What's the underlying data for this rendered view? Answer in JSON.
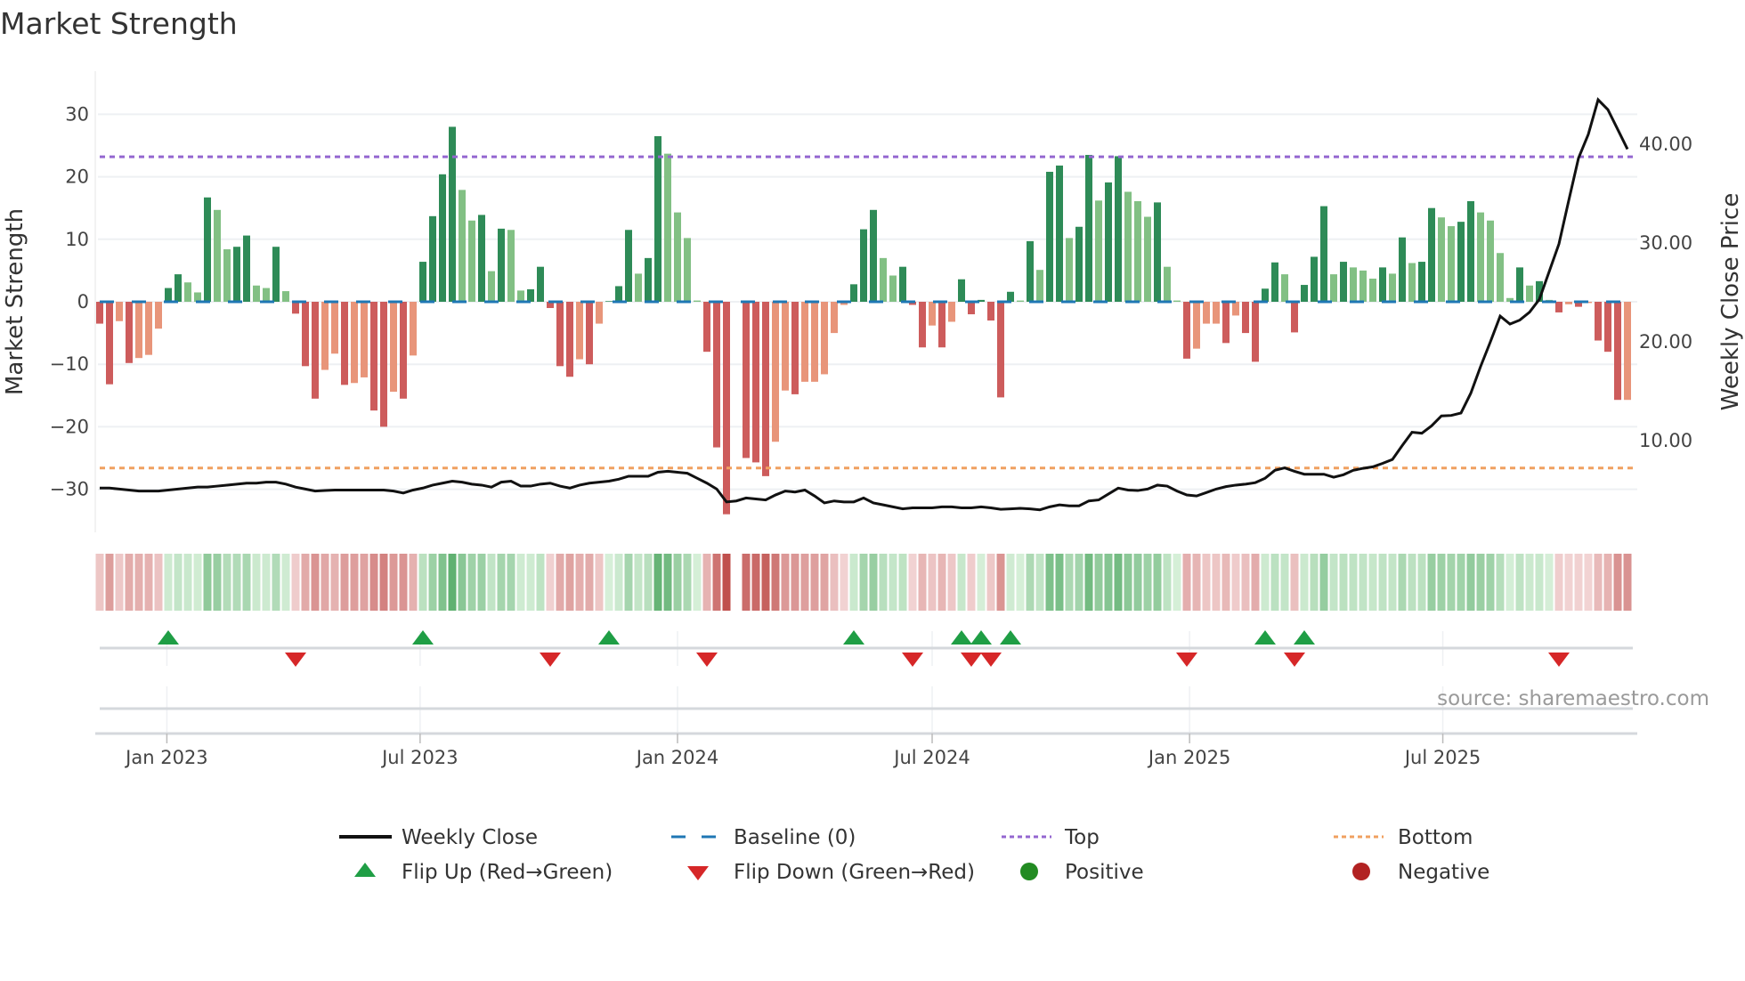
{
  "chart_data": {
    "type": "bar",
    "title": "Market Strength",
    "ylabel": "Market Strength",
    "y2label": "Weekly Close Price",
    "ylim": [
      -36,
      37
    ],
    "y2lim": [
      0,
      46
    ],
    "x_start": "2022-11-14",
    "x_step": "1 week",
    "yticks": [
      "30",
      "20",
      "10",
      "0",
      "−10",
      "−20",
      "−30"
    ],
    "ytick_values": [
      30,
      20,
      10,
      0,
      -10,
      -20,
      -30
    ],
    "y2ticks": [
      "40.00",
      "30.00",
      "20.00",
      "10.00"
    ],
    "y2tick_values": [
      40,
      30,
      20,
      10
    ],
    "xticks": [
      {
        "label": "Jan 2023",
        "date": "2023-01-01"
      },
      {
        "label": "Jul 2023",
        "date": "2023-07-01"
      },
      {
        "label": "Jan 2024",
        "date": "2024-01-01"
      },
      {
        "label": "Jul 2024",
        "date": "2024-07-01"
      },
      {
        "label": "Jan 2025",
        "date": "2025-01-01"
      },
      {
        "label": "Jul 2025",
        "date": "2025-07-01"
      }
    ],
    "top_level": 23.2,
    "bottom_level": -26.6,
    "baseline": 0,
    "strength": [
      -3.5,
      -13.2,
      -3.1,
      -9.8,
      -9,
      -8.5,
      -4.3,
      2.2,
      4.4,
      3.1,
      1.5,
      16.7,
      14.7,
      8.4,
      8.8,
      10.6,
      2.6,
      2.2,
      8.8,
      1.7,
      -1.9,
      -10.3,
      -15.5,
      -10.9,
      -8.3,
      -13.3,
      -13,
      -12.1,
      -17.4,
      -20,
      -14.4,
      -15.5,
      -8.6,
      6.4,
      13.7,
      20.4,
      28,
      17.9,
      13,
      13.9,
      4.9,
      11.7,
      11.5,
      1.8,
      2,
      5.6,
      -1,
      -10.3,
      -12,
      -9.2,
      -10,
      -3.5,
      0.1,
      2.5,
      11.5,
      4.5,
      7,
      26.5,
      23.7,
      14.3,
      10.2,
      0.2,
      -8,
      -23.3,
      -34,
      null,
      -25,
      -25.7,
      -27.9,
      -22.4,
      -14.2,
      -14.8,
      -12.8,
      -12.8,
      -11.6,
      -5,
      -0.5,
      2.8,
      11.6,
      14.7,
      7,
      4.2,
      5.6,
      -0.5,
      -7.3,
      -3.8,
      -7.3,
      -3.2,
      3.6,
      -2,
      0.3,
      -3,
      -15.3,
      1.6,
      0.2,
      9.7,
      5.1,
      20.8,
      21.8,
      10.2,
      12,
      23.5,
      16.2,
      19.1,
      23.3,
      17.6,
      16.1,
      13.6,
      15.9,
      5.6,
      0.2,
      -9.1,
      -7.5,
      -3.5,
      -3.5,
      -6.6,
      -2.2,
      -5,
      -9.6,
      2.1,
      6.3,
      4.4,
      -4.9,
      2.7,
      7.2,
      15.3,
      4.4,
      6.4,
      5.5,
      5,
      3.7,
      5.5,
      4.5,
      10.3,
      6.2,
      6.4,
      15,
      13.5,
      12.1,
      12.8,
      16.1,
      14.3,
      13,
      7.8,
      0.6,
      5.5,
      2.6,
      3.3,
      0.3,
      -1.7,
      -0.4,
      -0.8,
      -0.2,
      -6.2,
      -8,
      -15.7,
      -15.7
    ],
    "close": [
      5.2,
      5.2,
      5.1,
      5.0,
      4.9,
      4.9,
      4.9,
      5.0,
      5.1,
      5.2,
      5.3,
      5.3,
      5.4,
      5.5,
      5.6,
      5.7,
      5.7,
      5.8,
      5.8,
      5.6,
      5.3,
      5.1,
      4.9,
      4.95,
      5.0,
      5.0,
      5.0,
      5.0,
      5.0,
      5.0,
      4.9,
      4.7,
      5.0,
      5.2,
      5.5,
      5.7,
      5.9,
      5.8,
      5.6,
      5.5,
      5.3,
      5.8,
      5.9,
      5.4,
      5.4,
      5.6,
      5.7,
      5.4,
      5.2,
      5.5,
      5.7,
      5.8,
      5.9,
      6.1,
      6.4,
      6.4,
      6.4,
      6.8,
      6.9,
      6.8,
      6.7,
      6.2,
      5.7,
      5.1,
      3.8,
      3.9,
      4.2,
      4.1,
      4.0,
      4.5,
      4.9,
      4.8,
      5.0,
      4.4,
      3.7,
      3.9,
      3.8,
      3.8,
      4.2,
      3.7,
      3.5,
      3.3,
      3.1,
      3.2,
      3.2,
      3.2,
      3.3,
      3.3,
      3.2,
      3.2,
      3.3,
      3.2,
      3.05,
      3.1,
      3.15,
      3.1,
      3.0,
      3.3,
      3.5,
      3.4,
      3.4,
      3.9,
      4.0,
      4.6,
      5.2,
      5.0,
      4.95,
      5.1,
      5.5,
      5.4,
      4.9,
      4.5,
      4.4,
      4.75,
      5.1,
      5.35,
      5.5,
      5.6,
      5.75,
      6.2,
      7.0,
      7.25,
      6.9,
      6.6,
      6.6,
      6.6,
      6.3,
      6.55,
      7.0,
      7.2,
      7.35,
      7.7,
      8.1,
      9.5,
      10.85,
      10.75,
      11.5,
      12.5,
      12.55,
      12.8,
      14.8,
      17.5,
      20.0,
      22.6,
      21.8,
      22.2,
      23.0,
      24.3,
      27.1,
      29.9,
      34.3,
      38.6,
      41.0,
      44.5,
      43.5,
      41.5,
      39.5
    ],
    "flip_up_weeks": [
      7,
      33,
      52,
      77,
      88,
      90,
      93,
      119,
      123
    ],
    "flip_down_weeks": [
      20,
      46,
      62,
      83,
      89,
      91,
      111,
      122,
      149
    ],
    "legend": {
      "placement": "bottom",
      "items": [
        {
          "label": "Weekly Close",
          "kind": "line"
        },
        {
          "label": "Baseline (0)",
          "kind": "dash"
        },
        {
          "label": "Top",
          "kind": "dot"
        },
        {
          "label": "Bottom",
          "kind": "dot"
        },
        {
          "label": "Flip Up (Red→Green)",
          "kind": "tri-up"
        },
        {
          "label": "Flip Down (Green→Red)",
          "kind": "tri-down"
        },
        {
          "label": "Positive",
          "kind": "circle"
        },
        {
          "label": "Negative",
          "kind": "circle"
        }
      ]
    },
    "source": "source: sharemaestro.com",
    "colors": {
      "pos_strong": "#2e8b57",
      "pos_weak": "#82c084",
      "neg_strong": "#cd5c5c",
      "neg_weak": "#e8957a",
      "baseline": "#1f77b4",
      "top": "#9467d0",
      "bottom": "#f0a060",
      "close": "#111111",
      "flip_up": "#1f9e45",
      "flip_down": "#d62728",
      "positive": "#228b22",
      "negative": "#b22222"
    }
  }
}
